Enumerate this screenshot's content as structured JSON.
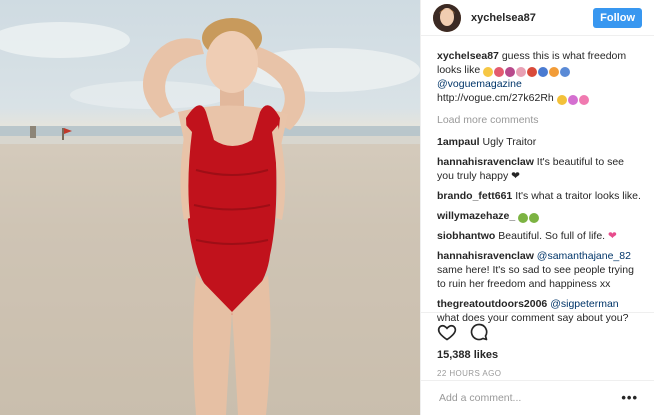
{
  "header": {
    "username": "xychelsea87",
    "follow_label": "Follow"
  },
  "caption": {
    "username": "xychelsea87",
    "text": "guess this is what freedom looks like",
    "mention": "@voguemagazine",
    "link": "http://vogue.cm/27k62Rh"
  },
  "load_more_label": "Load more comments",
  "comments": [
    {
      "user": "1ampaul",
      "mention": "",
      "text": "Ugly Traitor"
    },
    {
      "user": "hannahisravenclaw",
      "mention": "",
      "text": "It's beautiful to see you truly happy"
    },
    {
      "user": "brando_fett661",
      "mention": "",
      "text": "It's what a traitor looks like."
    },
    {
      "user": "willymazehaze_",
      "mention": "",
      "text": ""
    },
    {
      "user": "siobhantwo",
      "mention": "",
      "text": "Beautiful. So full of life."
    },
    {
      "user": "hannahisravenclaw",
      "mention": "@samanthajane_82",
      "text": "same here! It's so sad to see people trying to ruin her freedom and happiness xx"
    },
    {
      "user": "thegreatoutdoors2006",
      "mention": "@sigpeterman",
      "text": "what does your comment say about you?"
    }
  ],
  "likes": "15,388 likes",
  "time": "22 HOURS AGO",
  "add_comment_placeholder": "Add a comment...",
  "more_options": "•••",
  "icons": {
    "like": "heart-outline-icon",
    "comment": "speech-bubble-icon",
    "more": "ellipsis-icon"
  },
  "colors": {
    "follow_button": "#3897f0",
    "swimsuit": "#c1121c",
    "mention": "#003569"
  }
}
